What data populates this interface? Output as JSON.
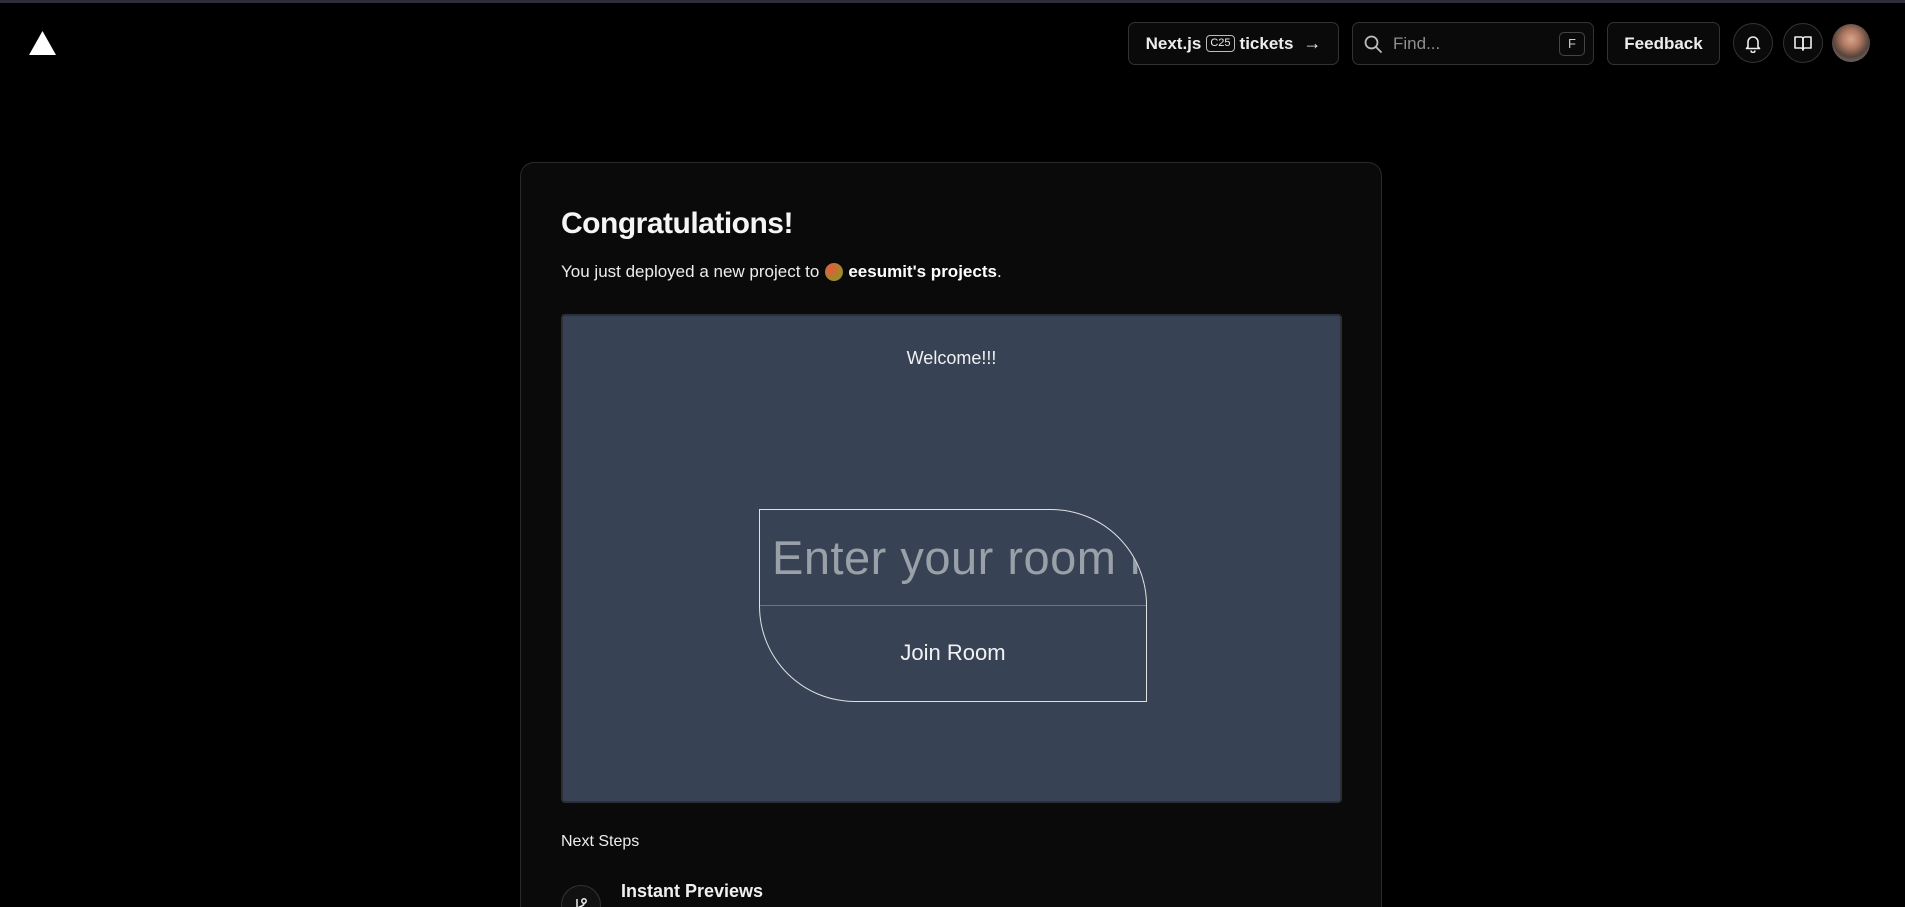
{
  "header": {
    "next_button": {
      "prefix": "Next.js",
      "badge": "C25",
      "suffix": "tickets",
      "arrow": "→"
    },
    "search": {
      "placeholder": "Find...",
      "shortcut": "F"
    },
    "feedback_label": "Feedback",
    "icons": [
      "logo-triangle-icon",
      "search-icon",
      "bell-icon",
      "book-icon",
      "arrow-right-icon"
    ]
  },
  "card": {
    "title": "Congratulations!",
    "subtitle_prefix": "You just deployed a new project to",
    "team_name": "eesumit's projects",
    "subtitle_suffix": ".",
    "preview": {
      "welcome": "Welcome!!!",
      "room_placeholder": "Enter your room id",
      "join_label": "Join Room"
    },
    "next_steps_label": "Next Steps",
    "steps": [
      {
        "title": "Instant Previews",
        "icon": "git-branch-icon"
      }
    ]
  },
  "colors": {
    "background": "#000000",
    "card": "#0a0a0a",
    "preview": "#374355"
  }
}
